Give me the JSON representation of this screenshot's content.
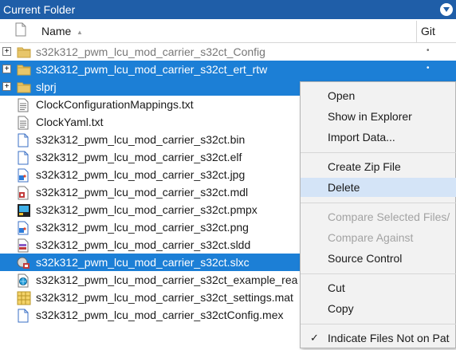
{
  "panel": {
    "title": "Current Folder"
  },
  "columns": {
    "name": "Name",
    "git": "Git"
  },
  "files": [
    {
      "label": "s32k312_pwm_lcu_mod_carrier_s32ct_Config",
      "icon": "folder-icon",
      "expandable": true,
      "selected": false,
      "dim": true,
      "git": "•"
    },
    {
      "label": "s32k312_pwm_lcu_mod_carrier_s32ct_ert_rtw",
      "icon": "folder-icon",
      "expandable": true,
      "selected": true,
      "dim": false,
      "git": "•"
    },
    {
      "label": "slprj",
      "icon": "folder-icon",
      "expandable": true,
      "selected": true,
      "dim": false,
      "git": ""
    },
    {
      "label": "ClockConfigurationMappings.txt",
      "icon": "text-file-icon",
      "expandable": false,
      "selected": false,
      "dim": false,
      "git": ""
    },
    {
      "label": "ClockYaml.txt",
      "icon": "text-file-icon",
      "expandable": false,
      "selected": false,
      "dim": false,
      "git": ""
    },
    {
      "label": "s32k312_pwm_lcu_mod_carrier_s32ct.bin",
      "icon": "blank-file-icon",
      "expandable": false,
      "selected": false,
      "dim": false,
      "git": ""
    },
    {
      "label": "s32k312_pwm_lcu_mod_carrier_s32ct.elf",
      "icon": "blank-file-icon",
      "expandable": false,
      "selected": false,
      "dim": false,
      "git": ""
    },
    {
      "label": "s32k312_pwm_lcu_mod_carrier_s32ct.jpg",
      "icon": "image-file-icon",
      "expandable": false,
      "selected": false,
      "dim": false,
      "git": ""
    },
    {
      "label": "s32k312_pwm_lcu_mod_carrier_s32ct.mdl",
      "icon": "model-file-icon",
      "expandable": false,
      "selected": false,
      "dim": false,
      "git": ""
    },
    {
      "label": "s32k312_pwm_lcu_mod_carrier_s32ct.pmpx",
      "icon": "pmpx-file-icon",
      "expandable": false,
      "selected": false,
      "dim": false,
      "git": ""
    },
    {
      "label": "s32k312_pwm_lcu_mod_carrier_s32ct.png",
      "icon": "image-file-icon",
      "expandable": false,
      "selected": false,
      "dim": false,
      "git": ""
    },
    {
      "label": "s32k312_pwm_lcu_mod_carrier_s32ct.sldd",
      "icon": "data-dictionary-icon",
      "expandable": false,
      "selected": false,
      "dim": false,
      "git": ""
    },
    {
      "label": "s32k312_pwm_lcu_mod_carrier_s32ct.slxc",
      "icon": "slxc-file-icon",
      "expandable": false,
      "selected": true,
      "dim": false,
      "git": ""
    },
    {
      "label": "s32k312_pwm_lcu_mod_carrier_s32ct_example_rea",
      "icon": "globe-file-icon",
      "expandable": false,
      "selected": false,
      "dim": false,
      "git": ""
    },
    {
      "label": "s32k312_pwm_lcu_mod_carrier_s32ct_settings.mat",
      "icon": "mat-file-icon",
      "expandable": false,
      "selected": false,
      "dim": false,
      "git": ""
    },
    {
      "label": "s32k312_pwm_lcu_mod_carrier_s32ctConfig.mex",
      "icon": "blank-file-icon",
      "expandable": false,
      "selected": false,
      "dim": false,
      "git": ""
    }
  ],
  "context_menu": [
    {
      "type": "item",
      "label": "Open",
      "disabled": false,
      "hover": false,
      "checked": false
    },
    {
      "type": "item",
      "label": "Show in Explorer",
      "disabled": false,
      "hover": false,
      "checked": false
    },
    {
      "type": "item",
      "label": "Import Data...",
      "disabled": false,
      "hover": false,
      "checked": false
    },
    {
      "type": "sep"
    },
    {
      "type": "item",
      "label": "Create Zip File",
      "disabled": false,
      "hover": false,
      "checked": false
    },
    {
      "type": "item",
      "label": "Delete",
      "disabled": false,
      "hover": true,
      "checked": false
    },
    {
      "type": "sep"
    },
    {
      "type": "item",
      "label": "Compare Selected Files/",
      "disabled": true,
      "hover": false,
      "checked": false
    },
    {
      "type": "item",
      "label": "Compare Against",
      "disabled": true,
      "hover": false,
      "checked": false
    },
    {
      "type": "item",
      "label": "Source Control",
      "disabled": false,
      "hover": false,
      "checked": false
    },
    {
      "type": "sep"
    },
    {
      "type": "item",
      "label": "Cut",
      "disabled": false,
      "hover": false,
      "checked": false
    },
    {
      "type": "item",
      "label": "Copy",
      "disabled": false,
      "hover": false,
      "checked": false
    },
    {
      "type": "sep"
    },
    {
      "type": "item",
      "label": "Indicate Files Not on Pat",
      "disabled": false,
      "hover": false,
      "checked": true
    }
  ],
  "colors": {
    "titlebar": "#1f5ea8",
    "selection": "#1c7fd6",
    "menu_hover": "#d4e4f7"
  }
}
